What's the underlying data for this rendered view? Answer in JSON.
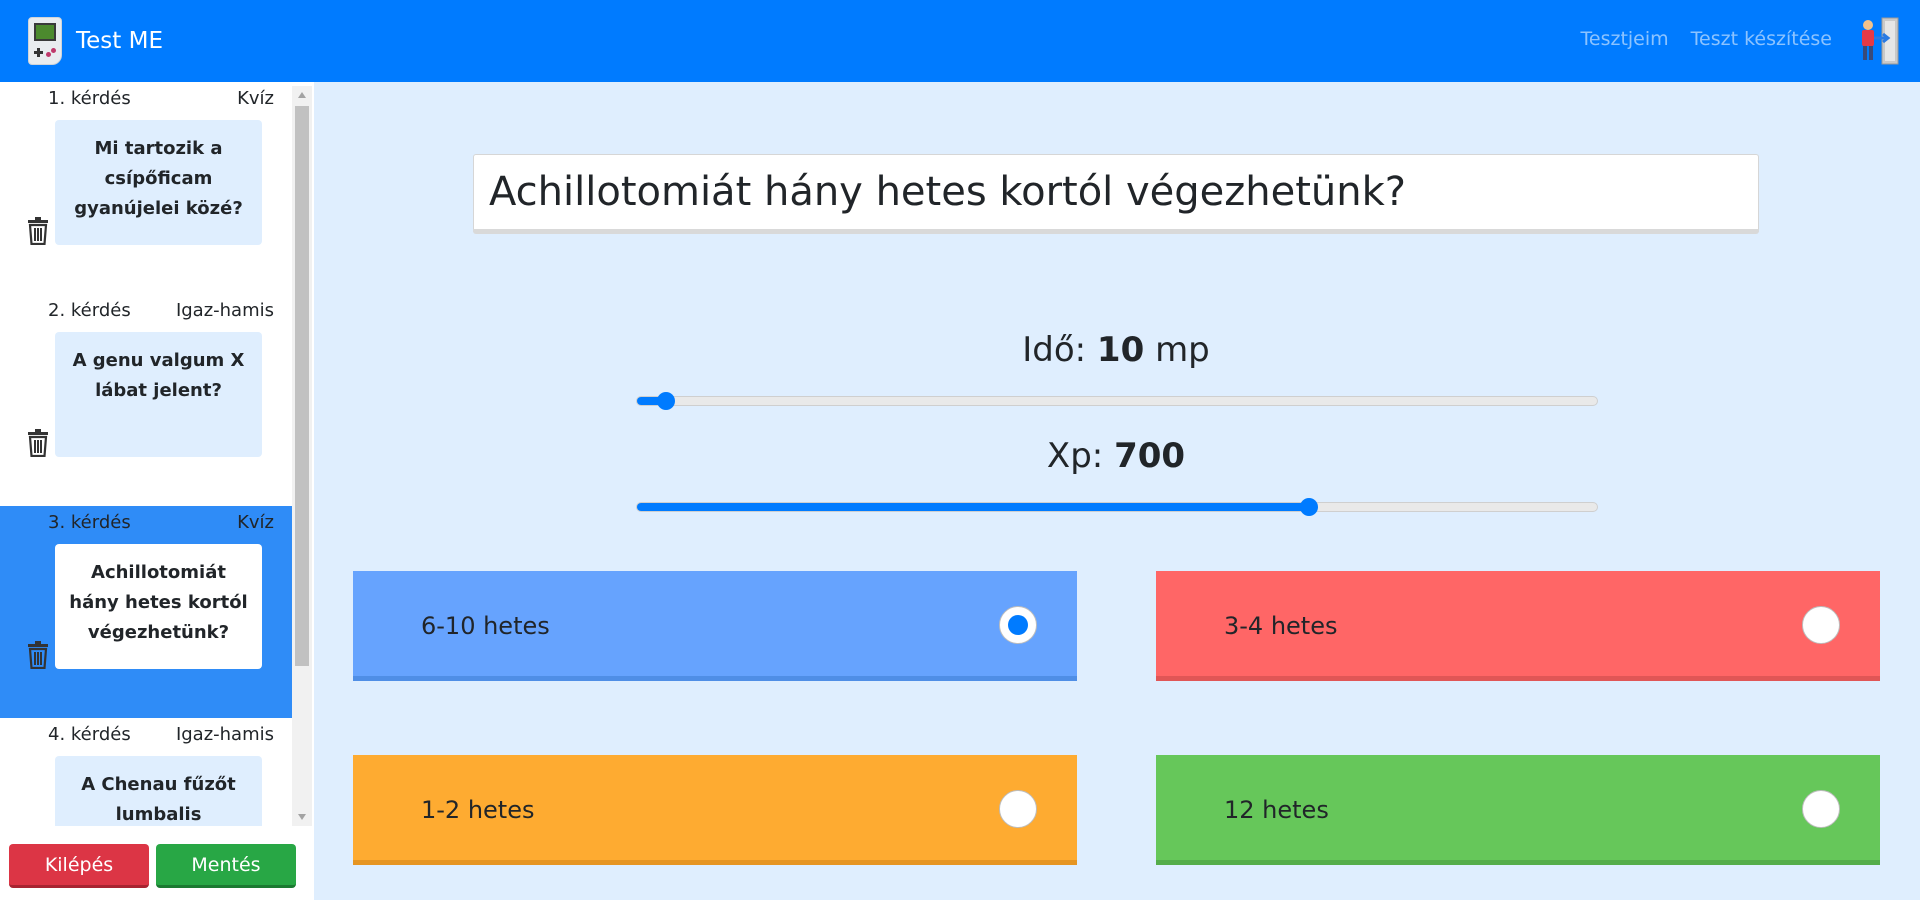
{
  "app": {
    "title": "Test ME"
  },
  "nav": {
    "links": [
      "Tesztjeim",
      "Teszt készítése"
    ]
  },
  "sidebar": {
    "items": [
      {
        "number": "1. kérdés",
        "type": "Kvíz",
        "text": "Mi tartozik a csípőficam gyanújelei közé?",
        "active": false
      },
      {
        "number": "2. kérdés",
        "type": "Igaz-hamis",
        "text": "A genu valgum X lábat jelent?",
        "active": false
      },
      {
        "number": "3. kérdés",
        "type": "Kvíz",
        "text": "Achillotomiát hány hetes kortól végezhetünk?",
        "active": true
      },
      {
        "number": "4. kérdés",
        "type": "Igaz-hamis",
        "text": "A Chenau fűzőt lumbalis",
        "active": false
      }
    ],
    "exit_label": "Kilépés",
    "save_label": "Mentés"
  },
  "main": {
    "question": "Achillotomiát hány hetes kortól végezhetünk?",
    "time": {
      "label": "Idő:",
      "value": "10",
      "unit": "mp",
      "fraction": 0.03
    },
    "xp": {
      "label": "Xp:",
      "value": "700",
      "fraction": 0.7
    },
    "answers": [
      {
        "text": "6-10 hetes",
        "color": "#66a3fe",
        "checked": true
      },
      {
        "text": "3-4 hetes",
        "color": "#ff6666",
        "checked": false
      },
      {
        "text": "1-2 hetes",
        "color": "#feab31",
        "checked": false
      },
      {
        "text": "12 hetes",
        "color": "#66c75a",
        "checked": false
      }
    ]
  },
  "colors": {
    "primary": "#007bff",
    "background": "#dfeefe",
    "danger": "#dc3545",
    "success": "#28a745"
  }
}
